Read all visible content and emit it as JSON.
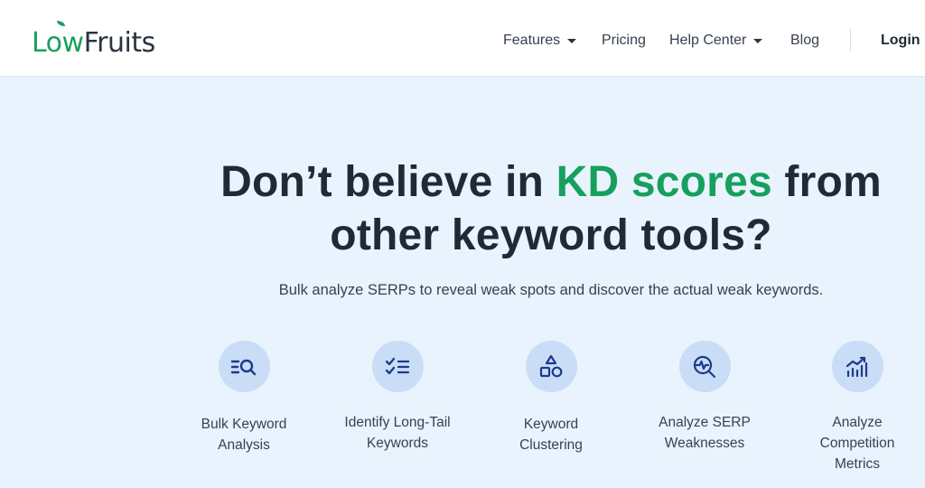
{
  "brand": {
    "part1": "Low",
    "part2": "Fruits"
  },
  "nav": {
    "features": "Features",
    "pricing": "Pricing",
    "help_center": "Help Center",
    "blog": "Blog",
    "login": "Login"
  },
  "hero": {
    "title_pre": "Don’t believe in ",
    "title_accent": "KD scores",
    "title_post_1": " from",
    "title_line2": "other keyword tools?",
    "subtitle": "Bulk analyze SERPs to reveal weak spots and discover the actual weak keywords."
  },
  "features": [
    {
      "line1": "Bulk Keyword",
      "line2": "Analysis",
      "line3": "",
      "icon": "list-search-icon"
    },
    {
      "line1": "Identify Long-Tail",
      "line2": "Keywords",
      "line3": "",
      "icon": "checklist-icon"
    },
    {
      "line1": "Keyword Clustering",
      "line2": "",
      "line3": "",
      "icon": "shapes-icon"
    },
    {
      "line1": "Analyze SERP",
      "line2": "Weaknesses",
      "line3": "",
      "icon": "zoom-pulse-icon"
    },
    {
      "line1": "Analyze",
      "line2": "Competition",
      "line3": "Metrics",
      "icon": "chart-trend-icon"
    }
  ],
  "colors": {
    "accent_green": "#17a05d",
    "hero_bg": "#e9f3fd",
    "icon_circle": "#c9ddf7",
    "icon_stroke": "#1e3a8a",
    "text_dark": "#1f2a37"
  }
}
